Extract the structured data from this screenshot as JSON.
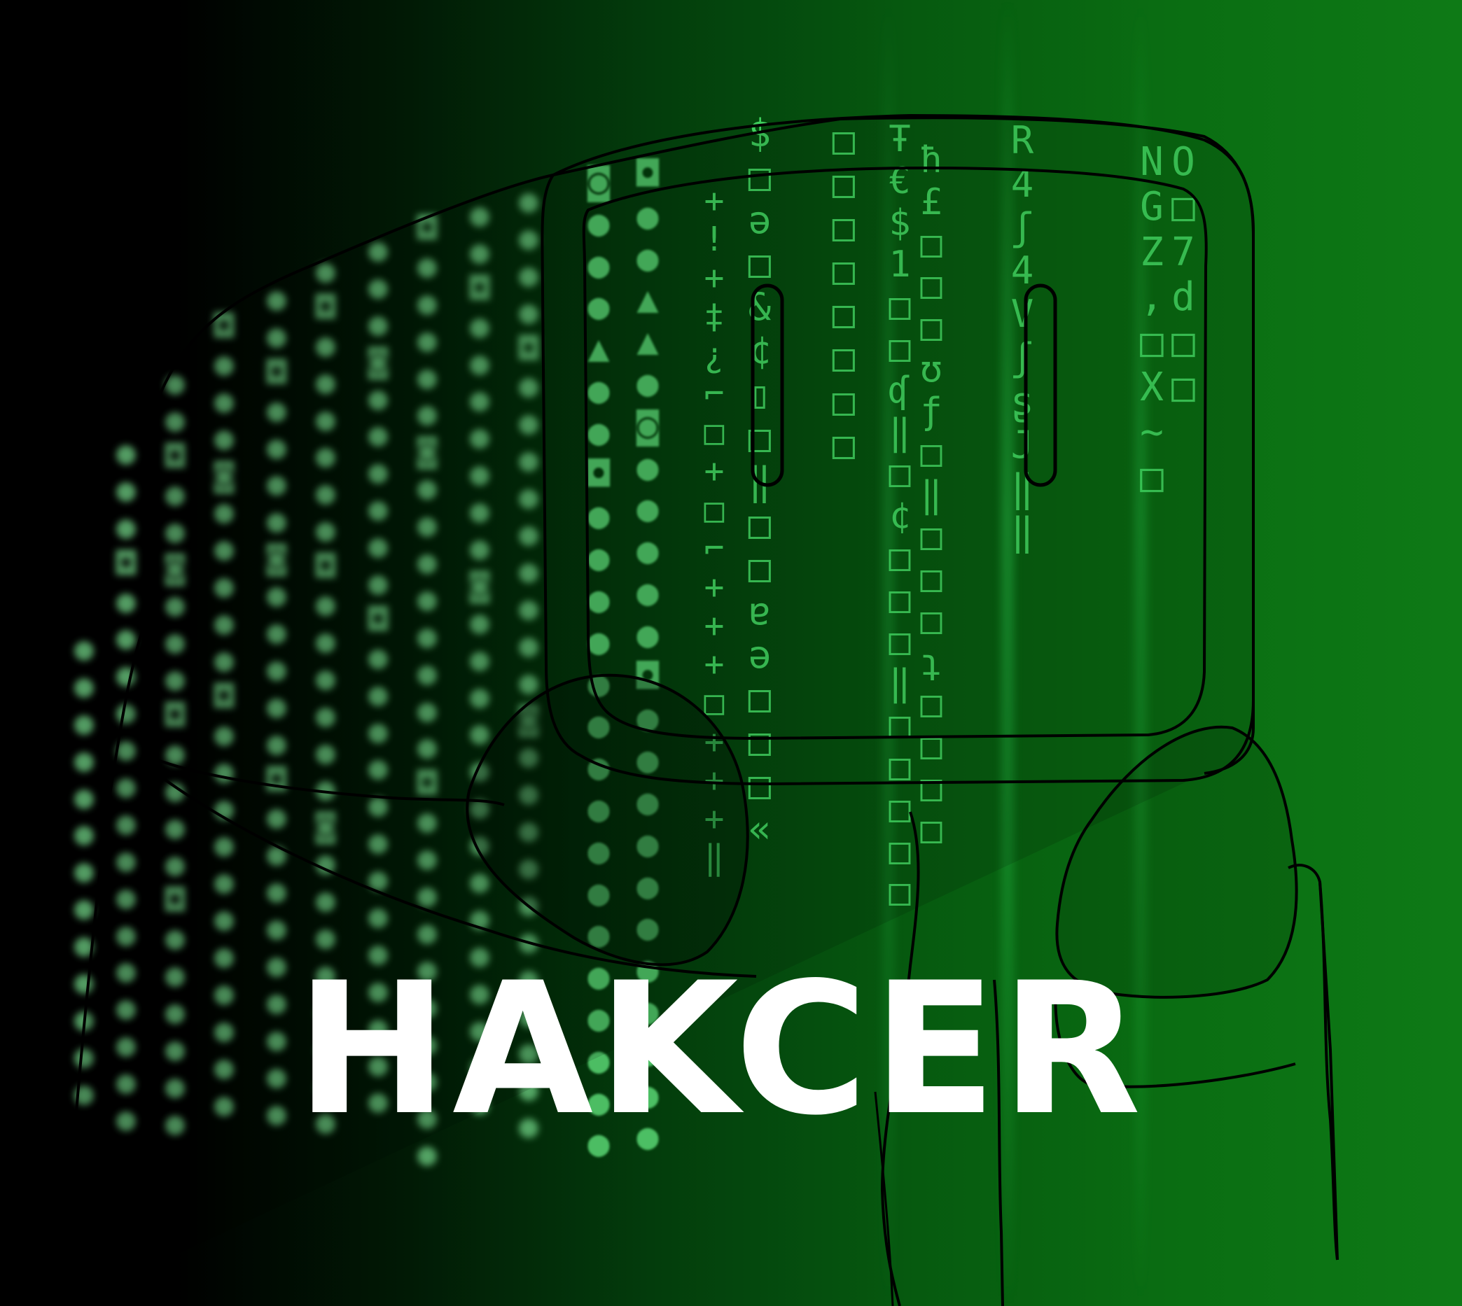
{
  "headline": "HAKCER",
  "colors": {
    "background_dark": "#000000",
    "background_green": "#0e7a16",
    "code_rain": "#5fe07a",
    "outline": "#000000",
    "headline_text": "#ffffff"
  },
  "illustration": {
    "subject": "hooded-hacker-figure",
    "background": "green-code-rain"
  }
}
